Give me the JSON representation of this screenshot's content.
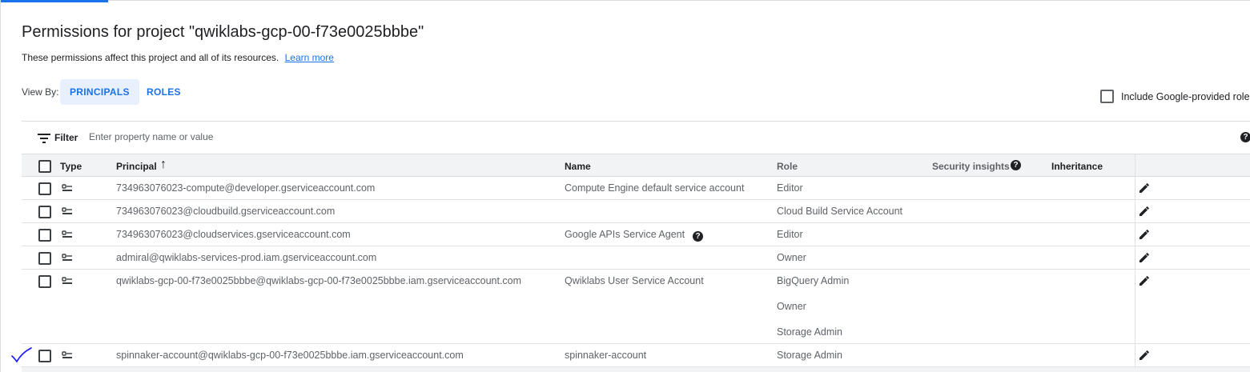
{
  "page": {
    "title": "Permissions for project \"qwiklabs-gcp-00-f73e0025bbbe\"",
    "subtitle": "These permissions affect this project and all of its resources.",
    "learn_more": "Learn more"
  },
  "view_by": {
    "label": "View By:",
    "tabs": [
      "PRINCIPALS",
      "ROLES"
    ],
    "active_tab": "PRINCIPALS"
  },
  "include_google_roles": {
    "label": "Include Google-provided role",
    "checked": false
  },
  "filter": {
    "label": "Filter",
    "placeholder": "Enter property name or value",
    "help_icon": "?"
  },
  "table": {
    "headers": {
      "type": "Type",
      "principal": "Principal",
      "name": "Name",
      "role": "Role",
      "security_insights": "Security insights",
      "inheritance": "Inheritance"
    },
    "sort": {
      "column": "Principal",
      "direction": "ascending",
      "arrow": "↑"
    },
    "rows": [
      {
        "principal": "734963076023-compute@developer.gserviceaccount.com",
        "name": "Compute Engine default service account",
        "roles": [
          "Editor"
        ],
        "name_help": false
      },
      {
        "principal": "734963076023@cloudbuild.gserviceaccount.com",
        "name": "",
        "roles": [
          "Cloud Build Service Account"
        ],
        "name_help": false
      },
      {
        "principal": "734963076023@cloudservices.gserviceaccount.com",
        "name": "Google APIs Service Agent",
        "roles": [
          "Editor"
        ],
        "name_help": true
      },
      {
        "principal": "admiral@qwiklabs-services-prod.iam.gserviceaccount.com",
        "name": "",
        "roles": [
          "Owner"
        ],
        "name_help": false
      },
      {
        "principal": "qwiklabs-gcp-00-f73e0025bbbe@qwiklabs-gcp-00-f73e0025bbbe.iam.gserviceaccount.com",
        "name": "Qwiklabs User Service Account",
        "roles": [
          "BigQuery Admin",
          "Owner",
          "Storage Admin"
        ],
        "name_help": false
      },
      {
        "principal": "spinnaker-account@qwiklabs-gcp-00-f73e0025bbbe.iam.gserviceaccount.com",
        "name": "spinnaker-account",
        "roles": [
          "Storage Admin"
        ],
        "name_help": false
      }
    ]
  },
  "icons": {
    "filter": "filter-list-icon",
    "sort": "arrow-upward-icon",
    "help": "help-circle-icon",
    "principal_type": "service-account-icon",
    "edit": "edit-pencil-icon",
    "annotation": "handwritten-checkmark"
  },
  "colors": {
    "accent": "#1a73e8",
    "header_bg": "#f1f3f4",
    "tab_active_bg": "#e8f0fe",
    "annotation": "#1a1aff"
  }
}
